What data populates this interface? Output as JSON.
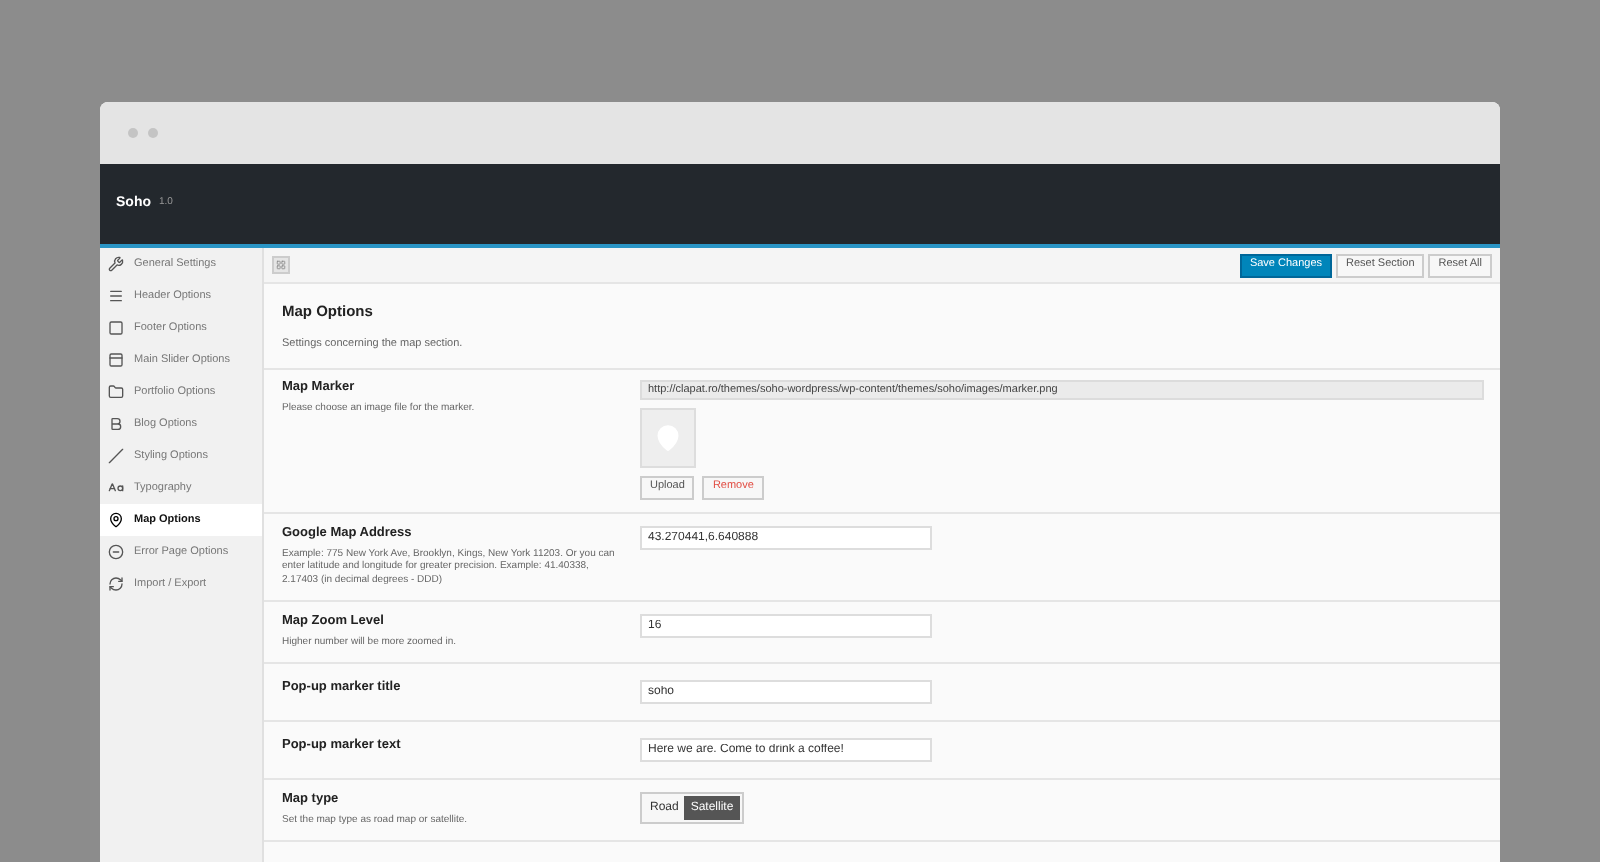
{
  "window": {
    "title": "Soho",
    "version": "1.0"
  },
  "sidebar": {
    "items": [
      {
        "label": "General Settings",
        "selected": false
      },
      {
        "label": "Header Options",
        "selected": false
      },
      {
        "label": "Footer Options",
        "selected": false
      },
      {
        "label": "Main Slider Options",
        "selected": false
      },
      {
        "label": "Portfolio Options",
        "selected": false
      },
      {
        "label": "Blog Options",
        "selected": false
      },
      {
        "label": "Styling Options",
        "selected": false
      },
      {
        "label": "Typography",
        "selected": false
      },
      {
        "label": "Map Options",
        "selected": true
      },
      {
        "label": "Error Page Options",
        "selected": false
      },
      {
        "label": "Import / Export",
        "selected": false
      }
    ]
  },
  "toolbar": {
    "buttons": [
      {
        "label": "Save Changes",
        "kind": "primary"
      },
      {
        "label": "Reset Section",
        "kind": "default"
      },
      {
        "label": "Reset All",
        "kind": "default"
      }
    ]
  },
  "section": {
    "title": "Map Options",
    "description": "Settings concerning the map section."
  },
  "fields": [
    {
      "kind": "media",
      "label": "Map Marker",
      "description": "Please choose an image file for the marker.",
      "value": "http://clapat.ro/themes/soho-wordpress/wp-content/themes/soho/images/marker.png",
      "buttons": [
        "Upload",
        "Remove"
      ]
    },
    {
      "kind": "text",
      "label": "Google Map Address",
      "description": "Example: 775 New York Ave, Brooklyn, Kings, New York 11203. Or you can enter latitude and longitude for greater precision. Example: 41.40338, 2.17403 (in decimal degrees - DDD)",
      "value": "43.270441,6.640888"
    },
    {
      "kind": "text",
      "label": "Map Zoom Level",
      "description": "Higher number will be more zoomed in.",
      "value": "16"
    },
    {
      "kind": "text",
      "label": "Pop-up marker title",
      "value": "soho"
    },
    {
      "kind": "text",
      "label": "Pop-up marker text",
      "value": "Here we are. Come to drink a coffee!"
    },
    {
      "kind": "buttonset",
      "label": "Map type",
      "description": "Set the map type as road map or satellite.",
      "options": [
        {
          "label": "Road",
          "selected": false
        },
        {
          "label": "Satellite",
          "selected": true
        }
      ]
    }
  ]
}
